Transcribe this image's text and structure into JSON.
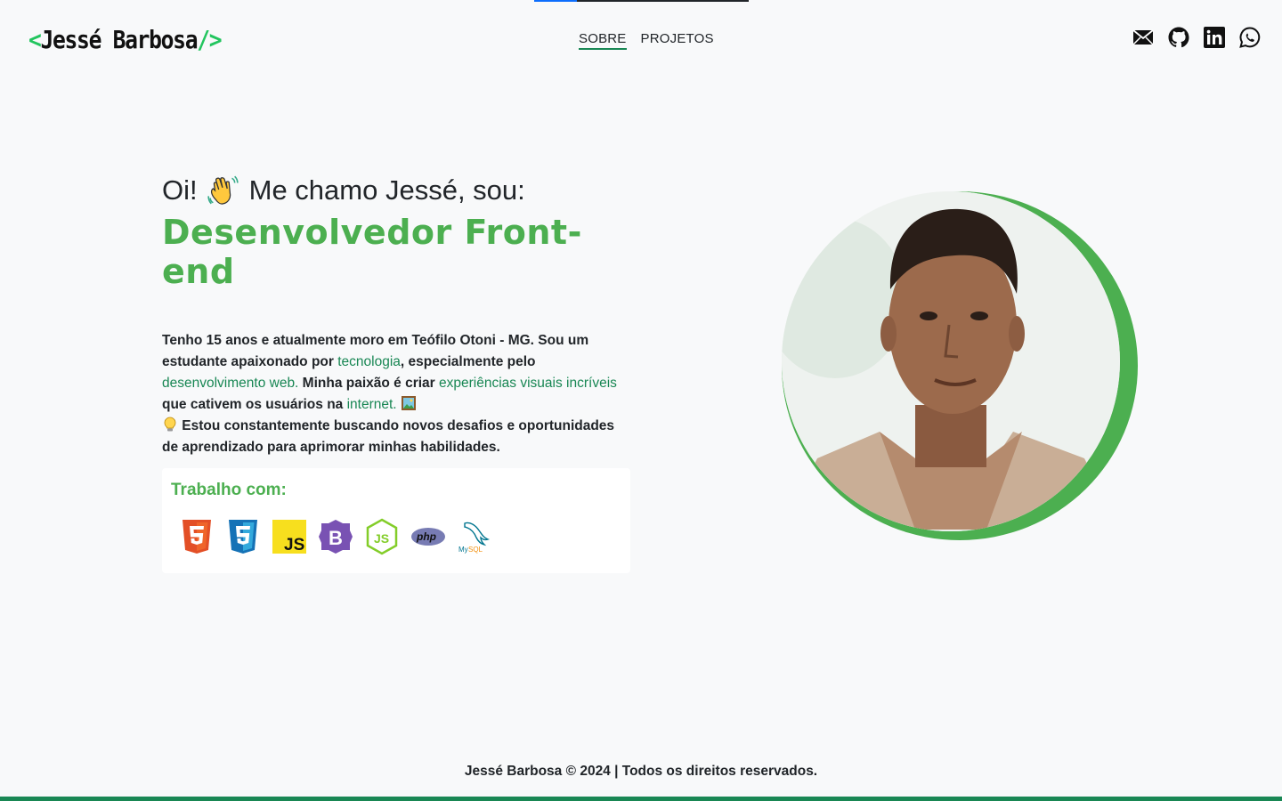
{
  "header": {
    "logo": {
      "open": "<",
      "name": "Jessé Barbosa",
      "close": "/>"
    },
    "nav": [
      {
        "label": "SOBRE",
        "active": true
      },
      {
        "label": "PROJETOS",
        "active": false
      }
    ],
    "socials": [
      "mail-icon",
      "github-icon",
      "linkedin-icon",
      "whatsapp-icon"
    ]
  },
  "hero": {
    "greeting_prefix": "Oi!",
    "greeting_suffix": "Me chamo Jessé, sou:",
    "role": "Desenvolvedor Front-end",
    "bio": {
      "p1": "Tenho 15 anos e atualmente moro em Teófilo Otoni - MG. Sou um estudante apaixonado por ",
      "hl1": "tecnologia",
      "p2": ", especialmente pelo ",
      "hl2": "desenvolvimento web.",
      "p3": " Minha paixão é criar ",
      "hl3": "experiências visuais incríveis",
      "p4": " que cativem os usuários na ",
      "hl4": "internet.",
      "p5": " Estou constantemente buscando novos desafios e oportunidades de aprendizado para aprimorar minhas habilidades."
    }
  },
  "stack": {
    "title": "Trabalho com:",
    "icons": [
      "html5-icon",
      "css3-icon",
      "javascript-icon",
      "bootstrap-icon",
      "nodejs-icon",
      "php-icon",
      "mysql-icon"
    ],
    "colors": {
      "html": "#e34f26",
      "css": "#1572b6",
      "js": "#f7df1e",
      "bootstrap": "#7952b3",
      "node": "#83cd29",
      "php": "#777bb3",
      "mysql": "#00758f"
    }
  },
  "footer": {
    "text": "Jessé Barbosa © 2024 | Todos os direitos reservados."
  },
  "colors": {
    "accent": "#4caf50",
    "link": "#198754",
    "background": "#f8f9fa"
  }
}
